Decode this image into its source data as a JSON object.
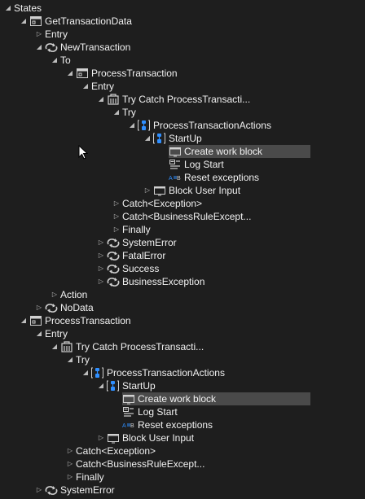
{
  "tree": [
    {
      "label": "States",
      "depth": 0,
      "arrow": "expanded",
      "icon": "none"
    },
    {
      "label": "GetTransactionData",
      "depth": 1,
      "arrow": "expanded",
      "icon": "sequence-window-icon"
    },
    {
      "label": "Entry",
      "depth": 2,
      "arrow": "collapsed",
      "icon": "none"
    },
    {
      "label": "NewTransaction",
      "depth": 2,
      "arrow": "expanded",
      "icon": "transition-icon"
    },
    {
      "label": "To",
      "depth": 3,
      "arrow": "expanded",
      "icon": "none"
    },
    {
      "label": "ProcessTransaction",
      "depth": 4,
      "arrow": "expanded",
      "icon": "sequence-window-icon"
    },
    {
      "label": "Entry",
      "depth": 5,
      "arrow": "expanded",
      "icon": "none"
    },
    {
      "label": "Try Catch ProcessTransacti...",
      "depth": 6,
      "arrow": "expanded",
      "icon": "try-catch-icon"
    },
    {
      "label": "Try",
      "depth": 7,
      "arrow": "expanded",
      "icon": "none"
    },
    {
      "label": "ProcessTransactionActions",
      "depth": 8,
      "arrow": "expanded",
      "icon": "sequence-icon",
      "bracket": true
    },
    {
      "label": "StartUp",
      "depth": 9,
      "arrow": "expanded",
      "icon": "sequence-icon",
      "bracket": true
    },
    {
      "label": "Create work block",
      "depth": 10,
      "arrow": "none",
      "icon": "window-icon",
      "selected": true
    },
    {
      "label": "Log Start",
      "depth": 10,
      "arrow": "none",
      "icon": "log-message-icon"
    },
    {
      "label": "Reset exceptions",
      "depth": 10,
      "arrow": "none",
      "icon": "assign-icon"
    },
    {
      "label": "Block User Input",
      "depth": 9,
      "arrow": "collapsed",
      "icon": "window-icon"
    },
    {
      "label": "Catch<Exception>",
      "depth": 7,
      "arrow": "collapsed",
      "icon": "none"
    },
    {
      "label": "Catch<BusinessRuleExcept...",
      "depth": 7,
      "arrow": "collapsed",
      "icon": "none"
    },
    {
      "label": "Finally",
      "depth": 7,
      "arrow": "collapsed",
      "icon": "none"
    },
    {
      "label": "SystemError",
      "depth": 6,
      "arrow": "collapsed",
      "icon": "transition-icon"
    },
    {
      "label": "FatalError",
      "depth": 6,
      "arrow": "collapsed",
      "icon": "transition-icon"
    },
    {
      "label": "Success",
      "depth": 6,
      "arrow": "collapsed",
      "icon": "transition-icon"
    },
    {
      "label": "BusinessException",
      "depth": 6,
      "arrow": "collapsed",
      "icon": "transition-icon"
    },
    {
      "label": "Action",
      "depth": 3,
      "arrow": "collapsed",
      "icon": "none"
    },
    {
      "label": "NoData",
      "depth": 2,
      "arrow": "collapsed",
      "icon": "transition-icon"
    },
    {
      "label": "ProcessTransaction",
      "depth": 1,
      "arrow": "expanded",
      "icon": "sequence-window-icon"
    },
    {
      "label": "Entry",
      "depth": 2,
      "arrow": "expanded",
      "icon": "none"
    },
    {
      "label": "Try Catch ProcessTransacti...",
      "depth": 3,
      "arrow": "expanded",
      "icon": "try-catch-icon"
    },
    {
      "label": "Try",
      "depth": 4,
      "arrow": "expanded",
      "icon": "none"
    },
    {
      "label": "ProcessTransactionActions",
      "depth": 5,
      "arrow": "expanded",
      "icon": "sequence-icon",
      "bracket": true
    },
    {
      "label": "StartUp",
      "depth": 6,
      "arrow": "expanded",
      "icon": "sequence-icon",
      "bracket": true
    },
    {
      "label": "Create work block",
      "depth": 7,
      "arrow": "none",
      "icon": "window-icon",
      "selected": true
    },
    {
      "label": "Log Start",
      "depth": 7,
      "arrow": "none",
      "icon": "log-message-icon"
    },
    {
      "label": "Reset exceptions",
      "depth": 7,
      "arrow": "none",
      "icon": "assign-icon"
    },
    {
      "label": "Block User Input",
      "depth": 6,
      "arrow": "collapsed",
      "icon": "window-icon"
    },
    {
      "label": "Catch<Exception>",
      "depth": 4,
      "arrow": "collapsed",
      "icon": "none"
    },
    {
      "label": "Catch<BusinessRuleExcept...",
      "depth": 4,
      "arrow": "collapsed",
      "icon": "none"
    },
    {
      "label": "Finally",
      "depth": 4,
      "arrow": "collapsed",
      "icon": "none"
    },
    {
      "label": "SystemError",
      "depth": 2,
      "arrow": "collapsed",
      "icon": "transition-icon"
    }
  ],
  "colors": {
    "background": "#1e1e1e",
    "text": "#f1f1f1",
    "selection": "#4a4a4a",
    "accent_blue": "#2f8fff",
    "icon_gray": "#d0d0d0"
  }
}
